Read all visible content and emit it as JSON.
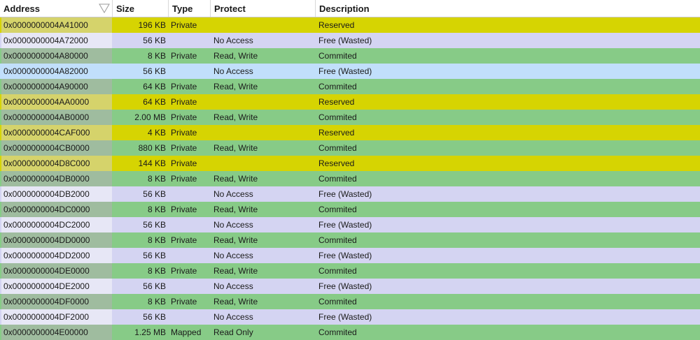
{
  "columns": [
    "Address",
    "Size",
    "Type",
    "Protect",
    "Description"
  ],
  "sort_icon": "sort-descending-triangle-icon",
  "colors": {
    "reserved_main": "#d6d402",
    "reserved_addr": "#d5d36b",
    "free_main": "#d4d4f2",
    "free_addr": "#e7e7f6",
    "free_selected_main": "#c1dffb",
    "free_selected_addr": "#c1dffb",
    "commited_main": "#87cb87",
    "commited_addr": "#9fbc9f"
  },
  "rows": [
    {
      "address": "0x0000000004A41000",
      "size": "196 KB",
      "type": "Private",
      "protect": "",
      "description": "Reserved",
      "kind": "reserved"
    },
    {
      "address": "0x0000000004A72000",
      "size": "56 KB",
      "type": "",
      "protect": "No Access",
      "description": "Free (Wasted)",
      "kind": "free"
    },
    {
      "address": "0x0000000004A80000",
      "size": "8 KB",
      "type": "Private",
      "protect": "Read, Write",
      "description": "Commited",
      "kind": "commited"
    },
    {
      "address": "0x0000000004A82000",
      "size": "56 KB",
      "type": "",
      "protect": "No Access",
      "description": "Free (Wasted)",
      "kind": "free_selected"
    },
    {
      "address": "0x0000000004A90000",
      "size": "64 KB",
      "type": "Private",
      "protect": "Read, Write",
      "description": "Commited",
      "kind": "commited"
    },
    {
      "address": "0x0000000004AA0000",
      "size": "64 KB",
      "type": "Private",
      "protect": "",
      "description": "Reserved",
      "kind": "reserved"
    },
    {
      "address": "0x0000000004AB0000",
      "size": "2.00 MB",
      "type": "Private",
      "protect": "Read, Write",
      "description": "Commited",
      "kind": "commited"
    },
    {
      "address": "0x0000000004CAF000",
      "size": "4 KB",
      "type": "Private",
      "protect": "",
      "description": "Reserved",
      "kind": "reserved"
    },
    {
      "address": "0x0000000004CB0000",
      "size": "880 KB",
      "type": "Private",
      "protect": "Read, Write",
      "description": "Commited",
      "kind": "commited"
    },
    {
      "address": "0x0000000004D8C000",
      "size": "144 KB",
      "type": "Private",
      "protect": "",
      "description": "Reserved",
      "kind": "reserved"
    },
    {
      "address": "0x0000000004DB0000",
      "size": "8 KB",
      "type": "Private",
      "protect": "Read, Write",
      "description": "Commited",
      "kind": "commited"
    },
    {
      "address": "0x0000000004DB2000",
      "size": "56 KB",
      "type": "",
      "protect": "No Access",
      "description": "Free (Wasted)",
      "kind": "free"
    },
    {
      "address": "0x0000000004DC0000",
      "size": "8 KB",
      "type": "Private",
      "protect": "Read, Write",
      "description": "Commited",
      "kind": "commited"
    },
    {
      "address": "0x0000000004DC2000",
      "size": "56 KB",
      "type": "",
      "protect": "No Access",
      "description": "Free (Wasted)",
      "kind": "free"
    },
    {
      "address": "0x0000000004DD0000",
      "size": "8 KB",
      "type": "Private",
      "protect": "Read, Write",
      "description": "Commited",
      "kind": "commited"
    },
    {
      "address": "0x0000000004DD2000",
      "size": "56 KB",
      "type": "",
      "protect": "No Access",
      "description": "Free (Wasted)",
      "kind": "free"
    },
    {
      "address": "0x0000000004DE0000",
      "size": "8 KB",
      "type": "Private",
      "protect": "Read, Write",
      "description": "Commited",
      "kind": "commited"
    },
    {
      "address": "0x0000000004DE2000",
      "size": "56 KB",
      "type": "",
      "protect": "No Access",
      "description": "Free (Wasted)",
      "kind": "free"
    },
    {
      "address": "0x0000000004DF0000",
      "size": "8 KB",
      "type": "Private",
      "protect": "Read, Write",
      "description": "Commited",
      "kind": "commited"
    },
    {
      "address": "0x0000000004DF2000",
      "size": "56 KB",
      "type": "",
      "protect": "No Access",
      "description": "Free (Wasted)",
      "kind": "free"
    },
    {
      "address": "0x0000000004E00000",
      "size": "1.25 MB",
      "type": "Mapped",
      "protect": "Read Only",
      "description": "Commited",
      "kind": "commited"
    }
  ]
}
